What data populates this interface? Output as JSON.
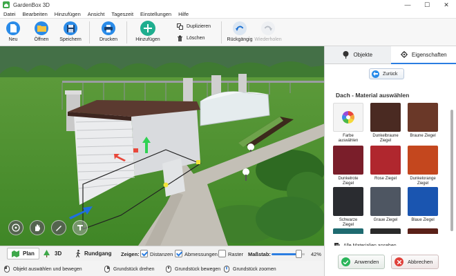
{
  "window": {
    "title": "GardenBox 3D",
    "minimize": "—",
    "maximize": "☐",
    "close": "✕"
  },
  "menu": [
    "Datei",
    "Bearbeiten",
    "Hinzufügen",
    "Ansicht",
    "Tageszeit",
    "Einstellungen",
    "Hilfe"
  ],
  "toolbar": {
    "new": "Neu",
    "open": "Öffnen",
    "save": "Speichern",
    "print": "Drucken",
    "add": "Hinzufügen",
    "duplicate": "Duplizieren",
    "delete": "Löschen",
    "undo": "Rückgängig",
    "redo": "Wiederholen"
  },
  "panel": {
    "tabs": {
      "objects": "Objekte",
      "properties": "Eigenschaften"
    },
    "back": "Zurück",
    "section_title": "Dach - Material auswählen",
    "materials": [
      {
        "label": "Farbe auswählen",
        "color": "#f4f4f4"
      },
      {
        "label": "Dunkelbraune Ziegel",
        "color": "#4a2a22"
      },
      {
        "label": "Braune Ziegel",
        "color": "#6a3828"
      },
      {
        "label": "Dunkelrote Ziegel",
        "color": "#7a1e2a"
      },
      {
        "label": "Rose Ziegel",
        "color": "#b0272e"
      },
      {
        "label": "Dunkelorange Ziegel",
        "color": "#c4471e"
      },
      {
        "label": "Schwarze Ziegel",
        "color": "#2a2c30"
      },
      {
        "label": "Graue Ziegel",
        "color": "#4e5662"
      },
      {
        "label": "Blaue Ziegel",
        "color": "#1a55b0"
      },
      {
        "label": "",
        "color": "#1f6a70"
      },
      {
        "label": "",
        "color": "#2a2a2a"
      },
      {
        "label": "",
        "color": "#5a2018"
      }
    ],
    "all_materials": "Alle Materialien ansehen",
    "apply": "Anwenden",
    "cancel": "Abbrechen"
  },
  "bottom": {
    "view_plan": "Plan",
    "view_3d": "3D",
    "view_walk": "Rundgang",
    "show": "Zeigen:",
    "distances": "Distanzen",
    "dimensions": "Abmessungen",
    "grid": "Raster",
    "scale_label": "Maßstab:",
    "scale_value": "42%",
    "scale_fraction": 0.42
  },
  "status": {
    "select_move": "Objekt auswählen und bewegen",
    "rotate_plot": "Grundstück drehen",
    "move_plot": "Grundstück bewegen",
    "zoom_plot": "Grundstück zoomen"
  },
  "colors": {
    "accent": "#2a7de1",
    "apply_green": "#2ab55a",
    "cancel_red": "#e0403a"
  }
}
